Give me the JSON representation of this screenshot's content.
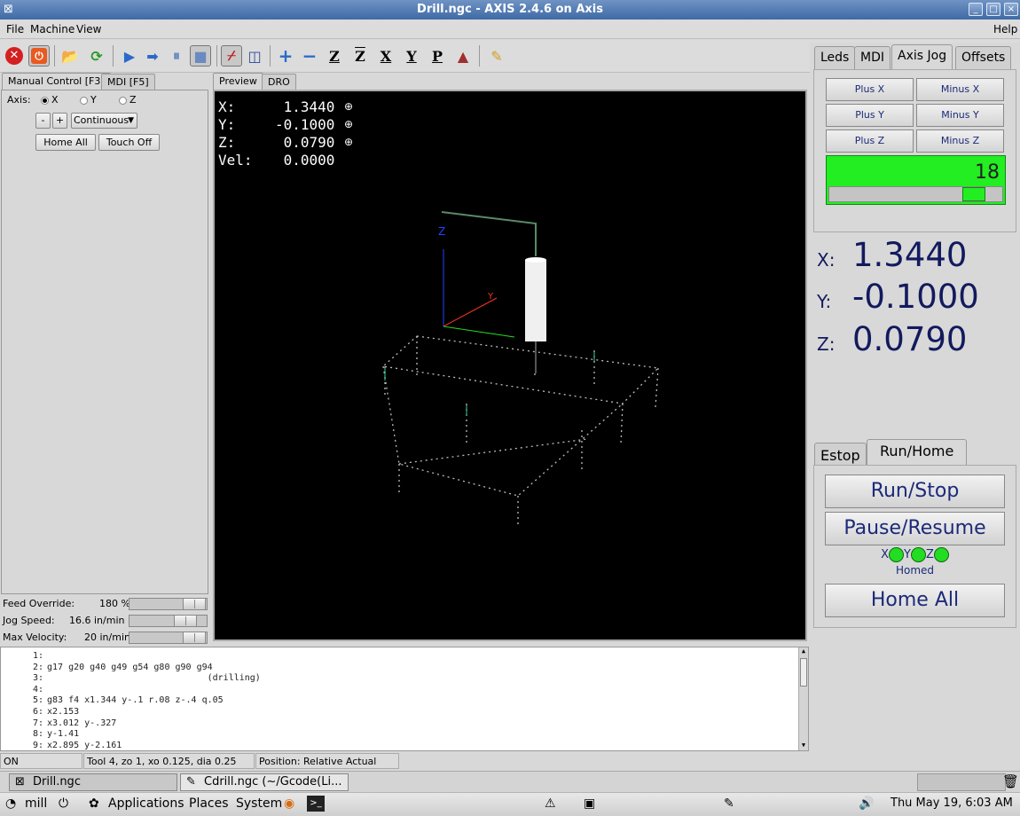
{
  "window": {
    "title": "Drill.ngc - AXIS 2.4.6 on Axis"
  },
  "menu": {
    "file": "File",
    "machine": "Machine",
    "view": "View",
    "help": "Help"
  },
  "toolbar": {
    "icons": [
      "estop-icon",
      "power-icon",
      "open-icon",
      "reload-icon",
      "run-icon",
      "step-icon",
      "pause-icon",
      "stop-icon",
      "block-delete-icon",
      "optional-stop-icon",
      "zoom-in-icon",
      "zoom-out-icon",
      "view-z-icon",
      "view-z2-icon",
      "view-x-icon",
      "view-y-icon",
      "view-p-icon",
      "rotate-icon",
      "clear-plot-icon"
    ]
  },
  "left": {
    "tabs": [
      "Manual Control [F3]",
      "MDI [F5]"
    ],
    "axis_label": "Axis:",
    "axes": [
      "X",
      "Y",
      "Z"
    ],
    "selected_axis": "X",
    "minus": "-",
    "plus": "+",
    "jog_mode": "Continuous",
    "home_all": "Home All",
    "touch_off": "Touch Off",
    "feed_override_label": "Feed Override:",
    "feed_override_value": "180 %",
    "jog_speed_label": "Jog Speed:",
    "jog_speed_value": "16.6 in/min",
    "max_velocity_label": "Max Velocity:",
    "max_velocity_value": "20 in/min"
  },
  "preview": {
    "tabs": [
      "Preview",
      "DRO"
    ],
    "lines": [
      {
        "label": "X:",
        "value": " 1.3440"
      },
      {
        "label": "Y:",
        "value": "-0.1000"
      },
      {
        "label": "Z:",
        "value": " 0.0790"
      },
      {
        "label": "Vel:",
        "value": " 0.0000"
      }
    ],
    "axis_labels": {
      "z": "Z",
      "y": "Y"
    }
  },
  "right": {
    "tabs": [
      "Leds",
      "MDI",
      "Axis Jog",
      "Offsets"
    ],
    "jog_buttons": [
      "Plus X",
      "Minus X",
      "Plus Y",
      "Minus Y",
      "Plus Z",
      "Minus Z"
    ],
    "jog_value": "18",
    "dro": [
      {
        "label": "X:",
        "value": "1.3440"
      },
      {
        "label": "Y:",
        "value": "-0.1000"
      },
      {
        "label": "Z:",
        "value": "0.0790"
      }
    ],
    "tabs2": [
      "Estop",
      "Run/Home"
    ],
    "run_stop": "Run/Stop",
    "pause_resume": "Pause/Resume",
    "led_labels": [
      "X",
      "Y",
      "Z"
    ],
    "homed": "Homed",
    "home_all": "Home All",
    "led_color": "#22dd22"
  },
  "gcode": [
    {
      "n": "1:",
      "text": ""
    },
    {
      "n": "2:",
      "text": "g17 g20 g40 g49 g54 g80 g90 g94"
    },
    {
      "n": "3:",
      "text": "                              (drilling)"
    },
    {
      "n": "4:",
      "text": ""
    },
    {
      "n": "5:",
      "text": "g83 f4 x1.344 y-.1 r.08 z-.4 q.05"
    },
    {
      "n": "6:",
      "text": "x2.153"
    },
    {
      "n": "7:",
      "text": "x3.012 y-.327"
    },
    {
      "n": "8:",
      "text": "y-1.41"
    },
    {
      "n": "9:",
      "text": "x2.895 y-2.161"
    }
  ],
  "status": {
    "state": "ON",
    "tool": "Tool 4, zo 1, xo 0.125, dia 0.25",
    "position": "Position: Relative Actual"
  },
  "taskbar": {
    "items": [
      "Drill.ngc",
      "Cdrill.ngc (~/Gcode(Li..."
    ]
  },
  "panel": {
    "user": "mill",
    "applications": "Applications",
    "places": "Places",
    "system": "System",
    "clock": "Thu May 19,  6:03 AM"
  }
}
